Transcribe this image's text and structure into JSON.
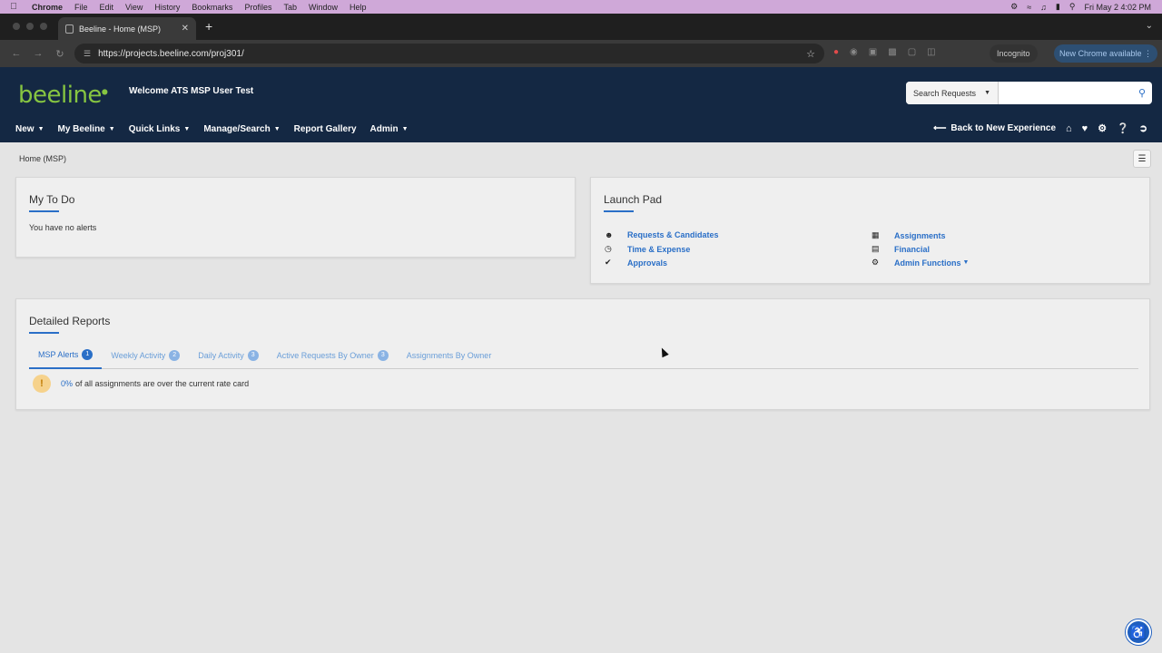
{
  "menubar": {
    "items": [
      "Chrome",
      "File",
      "Edit",
      "View",
      "History",
      "Bookmarks",
      "Profiles",
      "Tab",
      "Window",
      "Help"
    ],
    "datetime": "Fri May 2  4:02 PM"
  },
  "browser": {
    "tab_title": "Beeline - Home (MSP)",
    "url": "https://projects.beeline.com/proj301/",
    "incognito_label": "Incognito",
    "update_label": "New Chrome available"
  },
  "header": {
    "logo": "beeline",
    "welcome": "Welcome ATS MSP User Test",
    "search_select": "Search Requests",
    "search_placeholder": ""
  },
  "nav": {
    "items": [
      "New",
      "My Beeline",
      "Quick Links",
      "Manage/Search",
      "Report Gallery",
      "Admin"
    ],
    "back_label": "Back to New Experience"
  },
  "breadcrumb": "Home (MSP)",
  "todo": {
    "title": "My To Do",
    "message": "You have no alerts"
  },
  "launchpad": {
    "title": "Launch Pad",
    "left": [
      {
        "label": "Requests & Candidates",
        "icon": "users-icon"
      },
      {
        "label": "Time & Expense",
        "icon": "clock-icon"
      },
      {
        "label": "Approvals",
        "icon": "check-icon"
      }
    ],
    "right": [
      {
        "label": "Assignments",
        "icon": "calendar-icon"
      },
      {
        "label": "Financial",
        "icon": "bank-icon"
      },
      {
        "label": "Admin Functions",
        "icon": "cog-icon"
      }
    ]
  },
  "reports": {
    "title": "Detailed Reports",
    "tabs": [
      {
        "label": "MSP Alerts",
        "count": "1"
      },
      {
        "label": "Weekly Activity",
        "count": "2"
      },
      {
        "label": "Daily Activity",
        "count": "3"
      },
      {
        "label": "Active Requests By Owner",
        "count": "3"
      },
      {
        "label": "Assignments By Owner",
        "count": ""
      }
    ],
    "alert_pct": "0%",
    "alert_text": "of all assignments are over the current rate card"
  },
  "colors": {
    "header_bg": "#142843",
    "logo_green": "#86c541",
    "link_blue": "#2a6fc7"
  }
}
